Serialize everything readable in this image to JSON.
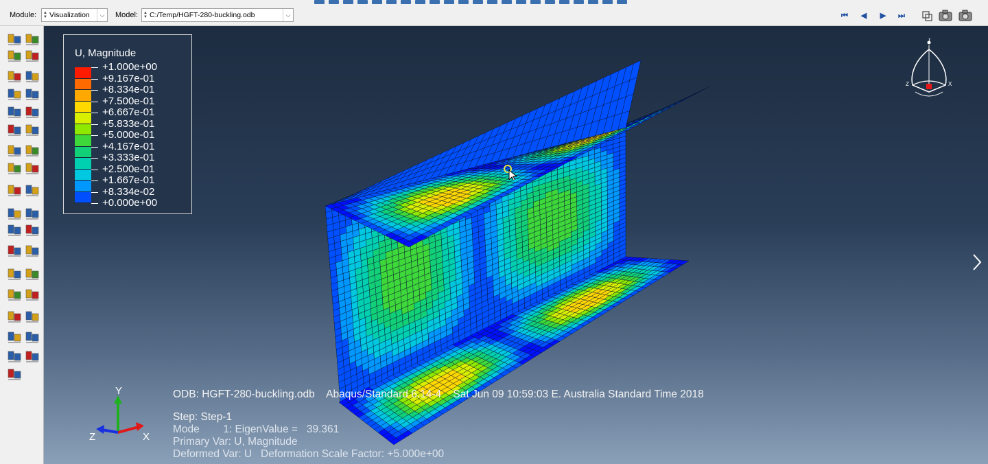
{
  "context_bar": {
    "module_label": "Module:",
    "module_value": "Visualization",
    "model_label": "Model:",
    "model_value": "C:/Temp/HGFT-280-buckling.odb"
  },
  "legend": {
    "title": "U, Magnitude",
    "values": [
      "+1.000e+00",
      "+9.167e-01",
      "+8.334e-01",
      "+7.500e-01",
      "+6.667e-01",
      "+5.833e-01",
      "+5.000e-01",
      "+4.167e-01",
      "+3.333e-01",
      "+2.500e-01",
      "+1.667e-01",
      "+8.334e-02",
      "+0.000e+00"
    ],
    "colors": [
      "#ff1a00",
      "#ff6a00",
      "#ffa800",
      "#ffd800",
      "#d8f000",
      "#8ee800",
      "#3ed83a",
      "#12d078",
      "#00d0b0",
      "#00c8e0",
      "#0098ff",
      "#0050ff",
      "#0010ff"
    ]
  },
  "triad": {
    "y_label": "Y",
    "z_label": "Z",
    "x_label": "X"
  },
  "info": {
    "odb_line": "ODB: HGFT-280-buckling.odb    Abaqus/Standard 6.14-4    Sat Jun 09 10:59:03 E. Australia Standard Time 2018",
    "step_line": "Step: Step-1",
    "mode_line": "Mode        1: EigenValue =   39.361",
    "primary_line": "Primary Var: U, Magnitude",
    "deformed_line": "Deformed Var: U   Deformation Scale Factor: +5.000e+00"
  },
  "view_cube": {
    "y_label": "Y",
    "z_label": "Z",
    "x_label": "X"
  },
  "colors": {
    "viewport_top": "#1d2c40",
    "viewport_bottom": "#8aa0b8",
    "legend_bg": "#23344b"
  }
}
